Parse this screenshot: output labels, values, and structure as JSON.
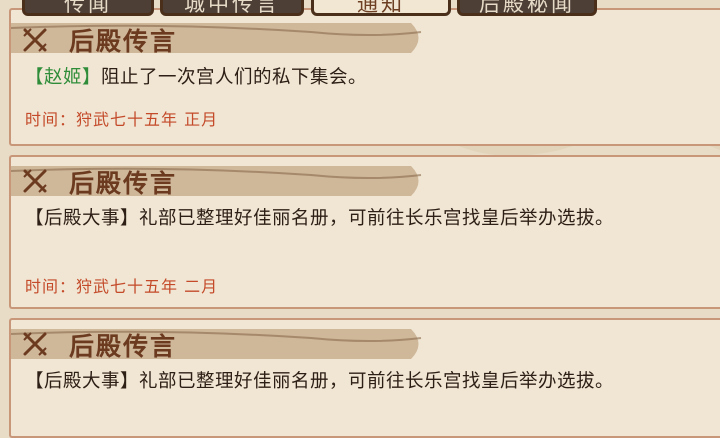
{
  "tabs": [
    {
      "label": "传闻",
      "active": false
    },
    {
      "label": "城中传言",
      "active": false
    },
    {
      "label": "通知",
      "active": true
    },
    {
      "label": "后殿秘闻",
      "active": false
    }
  ],
  "cards": [
    {
      "title": "后殿传言",
      "name": "【赵姬】",
      "text": "阻止了一次宫人们的私下集会。",
      "time_label": "时间：",
      "time_value": "狩武七十五年 正月"
    },
    {
      "title": "后殿传言",
      "text": "【后殿大事】礼部已整理好佳丽名册，可前往长乐宫找皇后举办选拔。",
      "time_label": "时间：",
      "time_value": "狩武七十五年 二月"
    },
    {
      "title": "后殿传言",
      "text": "【后殿大事】礼部已整理好佳丽名册，可前往长乐宫找皇后举办选拔。"
    }
  ],
  "colors": {
    "background": "#e9dcc6",
    "card": "#f0e6d3",
    "card_border": "#c8977a",
    "title": "#6b3a1f",
    "time": "#c44a2a",
    "name_green": "#2f8d3a",
    "tab_inactive": "#4d3e36"
  },
  "icons": [
    "crossed-swords-icon"
  ]
}
